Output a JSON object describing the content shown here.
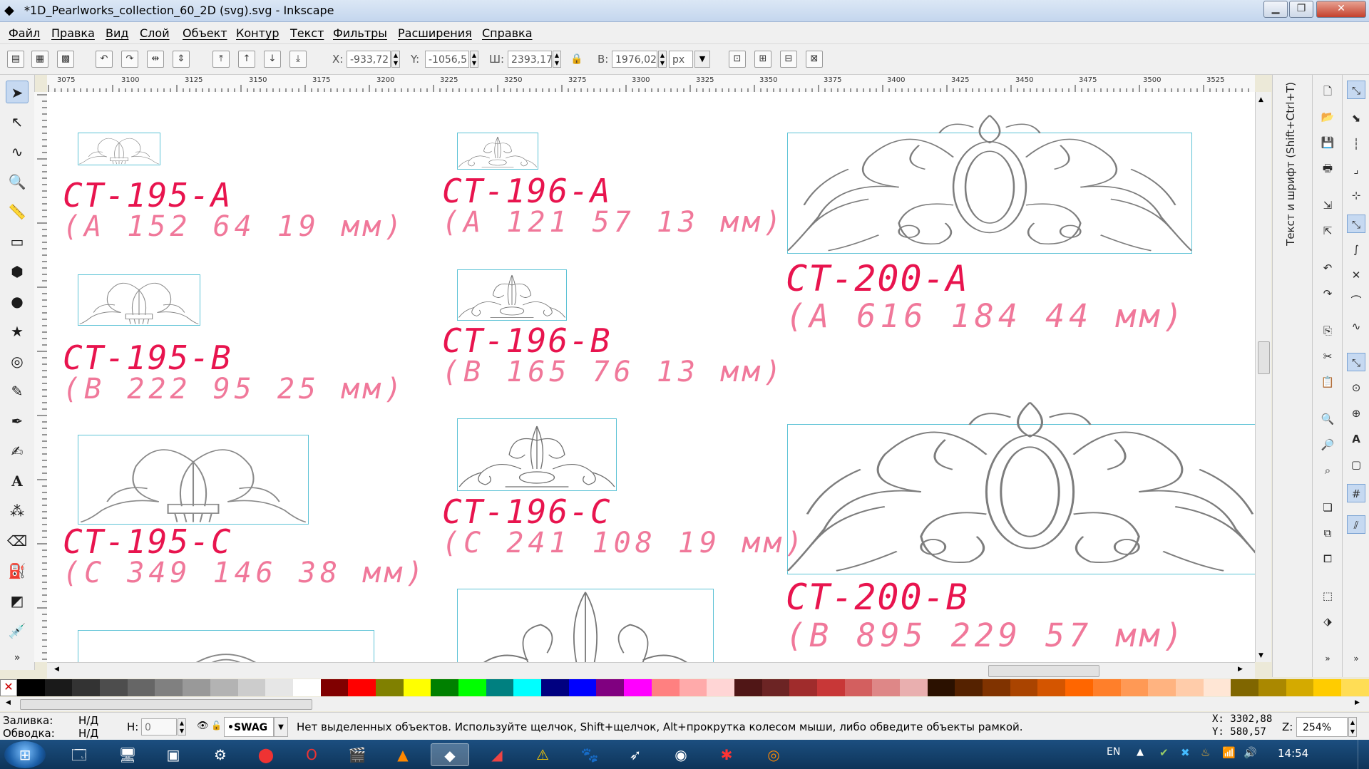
{
  "window": {
    "title": "*1D_Pearlworks_collection_60_2D (svg).svg - Inkscape"
  },
  "menu": [
    "Файл",
    "Правка",
    "Вид",
    "Слой",
    "Объект",
    "Контур",
    "Текст",
    "Фильтры",
    "Расширения",
    "Справка"
  ],
  "toolbar": {
    "x_label": "X:",
    "x_value": "-933,72",
    "y_label": "Y:",
    "y_value": "-1056,5",
    "w_label": "Ш:",
    "w_value": "2393,17",
    "h_label": "В:",
    "h_value": "1976,02",
    "unit": "px"
  },
  "ruler_labels": [
    "3075",
    "3100",
    "3125",
    "3150",
    "3175",
    "3200",
    "3225",
    "3250",
    "3275",
    "3300",
    "3325",
    "3350",
    "3375",
    "3400",
    "3425",
    "3450",
    "3475",
    "3500",
    "3525"
  ],
  "items": [
    {
      "code": "CT-195-A",
      "dims": "(A 152 64 19 мм)"
    },
    {
      "code": "CT-195-B",
      "dims": "(B 222 95 25 мм)"
    },
    {
      "code": "CT-195-C",
      "dims": "(C 349 146 38 мм)"
    },
    {
      "code": "CT-196-A",
      "dims": "(A 121 57 13 мм)"
    },
    {
      "code": "CT-196-B",
      "dims": "(B 165 76 13 мм)"
    },
    {
      "code": "CT-196-C",
      "dims": "(C 241 108 19 мм)"
    },
    {
      "code": "CT-200-A",
      "dims": "(A 616 184 44 мм)"
    },
    {
      "code": "CT-200-B",
      "dims": "(B 895 229 57 мм)"
    }
  ],
  "dock": {
    "title": "Текст и шрифт (Shift+Ctrl+T)"
  },
  "palette": [
    "#000000",
    "#1a1a1a",
    "#333333",
    "#4d4d4d",
    "#666666",
    "#808080",
    "#999999",
    "#b3b3b3",
    "#cccccc",
    "#e6e6e6",
    "#ffffff",
    "#800000",
    "#ff0000",
    "#808000",
    "#ffff00",
    "#008000",
    "#00ff00",
    "#008080",
    "#00ffff",
    "#000080",
    "#0000ff",
    "#800080",
    "#ff00ff",
    "#ff8080",
    "#ffaaaa",
    "#ffd5d5",
    "#501616",
    "#6c2424",
    "#a02c2c",
    "#c83737",
    "#d35f5f",
    "#de8787",
    "#e9afaf",
    "#2b1100",
    "#552200",
    "#803300",
    "#aa4400",
    "#d45500",
    "#ff6600",
    "#ff7f2a",
    "#ff9955",
    "#ffb380",
    "#ffccaa",
    "#ffe6d5",
    "#806600",
    "#aa8800",
    "#d4aa00",
    "#ffcc00",
    "#ffdd55"
  ],
  "status": {
    "fill_label": "Заливка:",
    "fill_value": "Н/Д",
    "stroke_label": "Обводка:",
    "stroke_value": "Н/Д",
    "h_label": "Н:",
    "h_value": "0",
    "layer": "•SWAG",
    "message": "Нет выделенных объектов. Используйте щелчок, Shift+щелчок, Alt+прокрутка колесом мыши, либо обведите объекты рамкой.",
    "x_coord": "X: 3302,88",
    "y_coord": "Y:  580,57",
    "zoom_label": "Z:",
    "zoom_value": "254%"
  },
  "taskbar": {
    "lang": "EN",
    "time": "14:54"
  },
  "colors": {
    "code": "#e8144e",
    "dims": "#f0789a",
    "bbox": "#5ec3d6"
  }
}
